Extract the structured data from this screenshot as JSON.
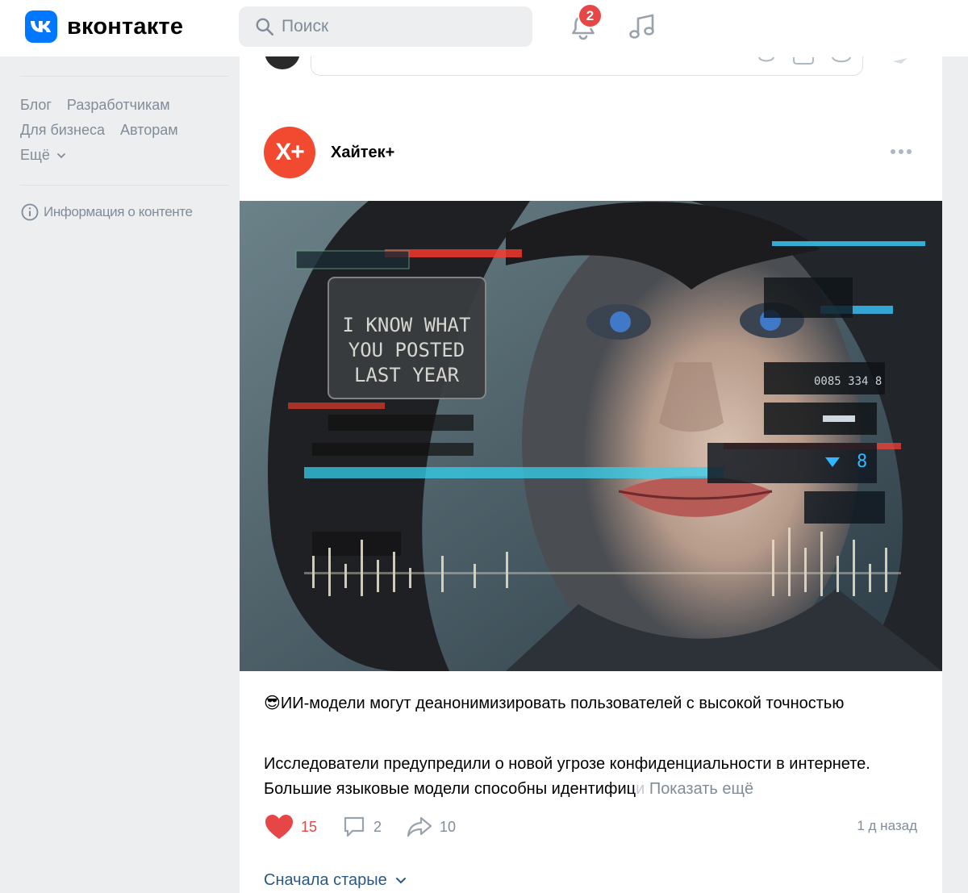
{
  "header": {
    "logo_text": "вконтакте",
    "search_placeholder": "Поиск",
    "notifications_count": "2"
  },
  "sidebar": {
    "links_row1": [
      "Блог",
      "Разработчикам"
    ],
    "links_row2": [
      "Для бизнеса",
      "Авторам"
    ],
    "more_label": "Ещё",
    "info_label": "Информация о контенте"
  },
  "post": {
    "author": "Хайтек+",
    "avatar_text": "X+",
    "image_text": [
      "I KNOW WHAT",
      "YOU POSTED",
      "LAST YEAR"
    ],
    "image_number": "0085 334 8",
    "image_counter": "8",
    "title": "😎ИИ-модели могут деанонимизировать пользователей с высокой точностью",
    "body_visible": "Исследователи предупредили о новой угрозе конфиденциальности в интернете. Большие языковые модели способны идентифиц",
    "body_faded": "и",
    "show_more": "Показать ещё",
    "likes": "15",
    "comments": "2",
    "shares": "10",
    "time": "1 д назад"
  },
  "comments_sort": "Сначала старые",
  "colors": {
    "brand": "#0077ff",
    "badge": "#e64646",
    "author_avatar": "#f14a30",
    "link": "#2a5885",
    "muted": "#818c99"
  }
}
